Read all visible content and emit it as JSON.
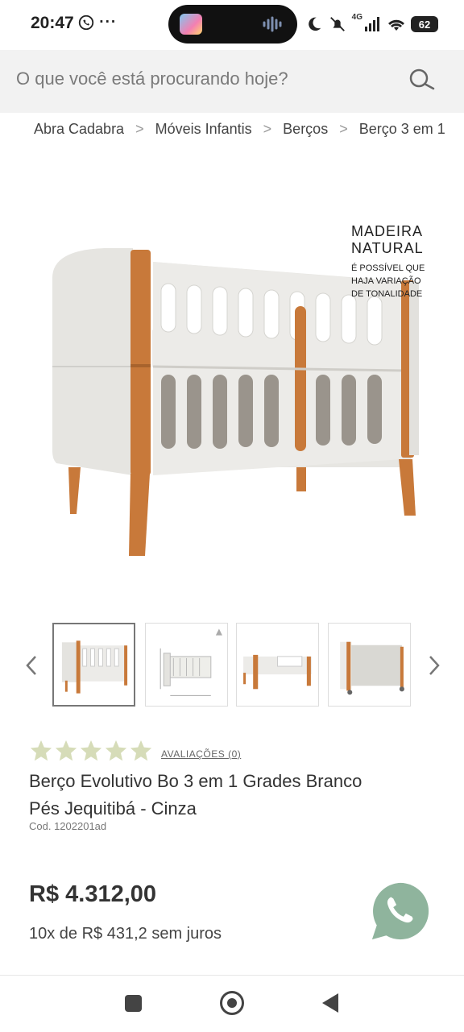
{
  "status_bar": {
    "time": "20:47",
    "left_icons": "whatsapp-icon, more-dots",
    "network": "4G",
    "battery": "62"
  },
  "search": {
    "placeholder": "O que você está procurando hoje?"
  },
  "breadcrumb": {
    "items": [
      "Abra Cadabra",
      "Móveis Infantis",
      "Berços",
      "Berço 3 em 1"
    ]
  },
  "image_overlay": {
    "title_line1": "MADEIRA",
    "title_line2": "NATURAL",
    "sub_line1": "É POSSÍVEL QUE",
    "sub_line2": "HAJA VARIAÇÃO",
    "sub_line3": "DE TONALIDADE"
  },
  "thumbnails": {
    "count": 4,
    "selected_index": 0
  },
  "rating": {
    "stars_filled": 0,
    "stars_total": 5,
    "reviews_label": "AVALIAÇÕES (0)"
  },
  "product": {
    "title_line1": "Berço Evolutivo Bo 3 em 1 Grades Branco",
    "title_line2": "Pés Jequitibá - Cinza",
    "code": "Cod. 1202201ad",
    "price": "R$ 4.312,00",
    "installments": "10x de R$ 431,2 sem juros"
  },
  "colors": {
    "wood": "#c8793a",
    "crib_white": "#ecebe8",
    "star": "#d6dcb8",
    "whatsapp": "#8fb49d"
  }
}
